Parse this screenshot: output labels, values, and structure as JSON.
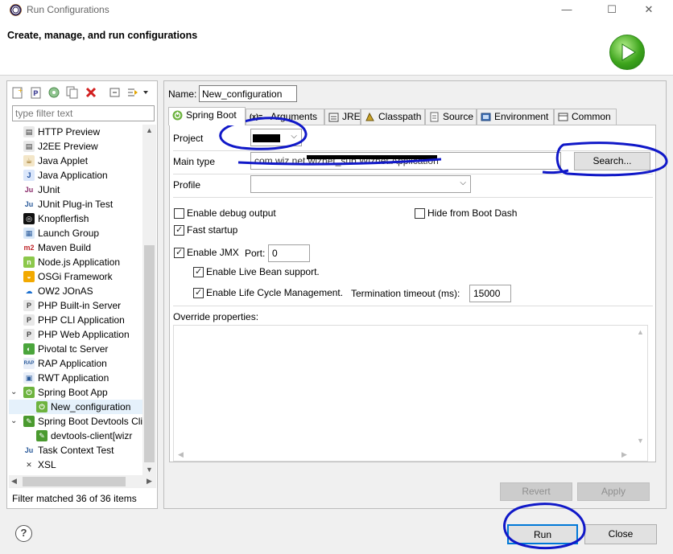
{
  "window": {
    "title": "Run Configurations",
    "minimize": "—",
    "maximize": "☐",
    "close": "✕"
  },
  "header": {
    "text": "Create, manage, and run configurations"
  },
  "left": {
    "filter_placeholder": "type filter text",
    "items": [
      {
        "label": "HTTP Preview",
        "icon": "http-preview-icon",
        "indent": 1
      },
      {
        "label": "J2EE Preview",
        "icon": "j2ee-preview-icon",
        "indent": 1
      },
      {
        "label": "Java Applet",
        "icon": "java-applet-icon",
        "indent": 1
      },
      {
        "label": "Java Application",
        "icon": "java-application-icon",
        "indent": 1
      },
      {
        "label": "JUnit",
        "icon": "junit-icon",
        "indent": 1
      },
      {
        "label": "JUnit Plug-in Test",
        "icon": "junit-plugin-icon",
        "indent": 1
      },
      {
        "label": "Knopflerfish",
        "icon": "knopflerfish-icon",
        "indent": 1
      },
      {
        "label": "Launch Group",
        "icon": "launch-group-icon",
        "indent": 1
      },
      {
        "label": "Maven Build",
        "icon": "maven-icon",
        "indent": 1
      },
      {
        "label": "Node.js Application",
        "icon": "nodejs-icon",
        "indent": 1
      },
      {
        "label": "OSGi Framework",
        "icon": "osgi-icon",
        "indent": 1
      },
      {
        "label": "OW2 JOnAS",
        "icon": "jonas-icon",
        "indent": 1
      },
      {
        "label": "PHP Built-in Server",
        "icon": "php-icon",
        "indent": 1
      },
      {
        "label": "PHP CLI Application",
        "icon": "php-icon",
        "indent": 1
      },
      {
        "label": "PHP Web Application",
        "icon": "php-icon",
        "indent": 1
      },
      {
        "label": "Pivotal tc Server",
        "icon": "tc-server-icon",
        "indent": 1
      },
      {
        "label": "RAP Application",
        "icon": "rap-icon",
        "indent": 1
      },
      {
        "label": "RWT Application",
        "icon": "rwt-icon",
        "indent": 1
      },
      {
        "label": "Spring Boot App",
        "icon": "spring-boot-icon",
        "indent": 1,
        "expanded": true
      },
      {
        "label": "New_configuration",
        "icon": "spring-boot-icon",
        "indent": 2,
        "selected": true
      },
      {
        "label": "Spring Boot Devtools Client",
        "icon": "spring-devtools-icon",
        "indent": 1,
        "expanded": true
      },
      {
        "label": "devtools-client[wizr",
        "icon": "spring-devtools-icon",
        "indent": 2
      },
      {
        "label": "Task Context Test",
        "icon": "task-context-icon",
        "indent": 1
      },
      {
        "label": "XSL",
        "icon": "xsl-icon",
        "indent": 1
      }
    ],
    "filter_status": "Filter matched 36 of 36 items"
  },
  "config": {
    "name_label": "Name:",
    "name_value": "New_configuration",
    "tabs": [
      {
        "label": "Spring Boot",
        "icon": "spring-boot-icon"
      },
      {
        "label": "Arguments",
        "icon": "arguments-icon"
      },
      {
        "label": "JRE",
        "icon": "jre-icon"
      },
      {
        "label": "Classpath",
        "icon": "classpath-icon"
      },
      {
        "label": "Source",
        "icon": "source-icon"
      },
      {
        "label": "Environment",
        "icon": "environment-icon"
      },
      {
        "label": "Common",
        "icon": "common-icon"
      }
    ],
    "active_tab": "Spring Boot",
    "project_label": "Project",
    "project_value": "",
    "main_type_label": "Main type",
    "main_type_value": "com.wiz.net.wizhet_sub.Wizhet.Application",
    "search_button": "Search...",
    "profile_label": "Profile",
    "profile_value": "",
    "debug_output": {
      "label": "Enable debug output",
      "checked": false
    },
    "hide_boot_dash": {
      "label": "Hide from Boot Dash",
      "checked": false
    },
    "fast_startup": {
      "label": "Fast startup",
      "checked": true
    },
    "enable_jmx": {
      "label": "Enable JMX",
      "checked": true
    },
    "port_label": "Port:",
    "port_value": "0",
    "live_bean": {
      "label": "Enable Live Bean support.",
      "checked": true
    },
    "life_cycle": {
      "label": "Enable Life Cycle Management.",
      "checked": true
    },
    "termination_label": "Termination timeout (ms):",
    "termination_value": "15000",
    "override_label": "Override properties:",
    "revert_button": "Revert",
    "apply_button": "Apply"
  },
  "footer": {
    "help": "?",
    "run_button": "Run",
    "close_button": "Close"
  },
  "colors": {
    "annotation_ink": "#1018c8",
    "selection": "#e5f1fb",
    "spring_green": "#6db33f"
  }
}
